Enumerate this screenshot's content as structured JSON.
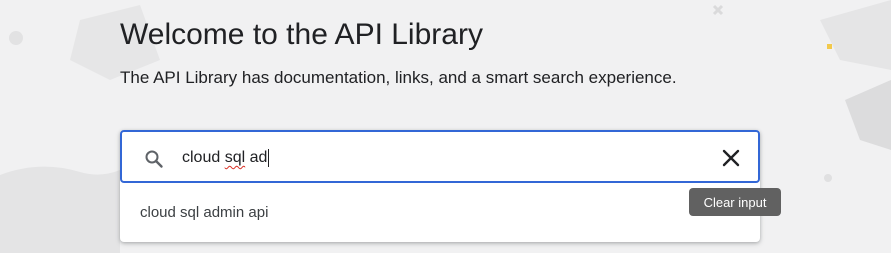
{
  "header": {
    "title": "Welcome to the API Library",
    "subtitle": "The API Library has documentation, links, and a smart search experience."
  },
  "search": {
    "value_prefix": "cloud ",
    "value_misspelled": "sql",
    "value_suffix": " ad",
    "icon": "search-icon",
    "clear_icon": "close-icon",
    "suggestions": [
      {
        "label": "cloud sql admin api"
      }
    ]
  },
  "tooltip": {
    "text": "Clear input"
  },
  "colors": {
    "accent": "#3367d6",
    "background": "#f1f1f2",
    "tooltip_bg": "#616161",
    "spellcheck": "#d93025"
  }
}
